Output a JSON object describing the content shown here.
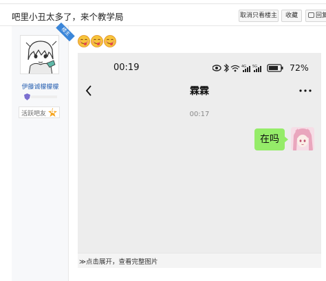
{
  "thread": {
    "title": "吧里小丑太多了，来个教学局"
  },
  "header_buttons": {
    "only_op": "取消只看楼主",
    "favorite": "收藏",
    "reply": "回复"
  },
  "author": {
    "badge": "楼主",
    "username": "伊藤诚檬檬檬",
    "level_name": "活跃吧友",
    "level": "4"
  },
  "colors": {
    "accent_blue": "#3b86d9",
    "username_blue": "#2d64b3",
    "bubble_green": "#95ec69",
    "chat_bg": "#ededed",
    "level_badge": "#f5a623"
  },
  "emojis": [
    "tongue-face-icon",
    "tongue-face-icon",
    "tongue-face-icon"
  ],
  "screenshot": {
    "status_time": "00:19",
    "battery": "72%",
    "chat_title": "霖霖",
    "message_time": "00:17",
    "message": "在吗"
  },
  "expand": {
    "label": "≫点击展开，查看完整图片"
  }
}
